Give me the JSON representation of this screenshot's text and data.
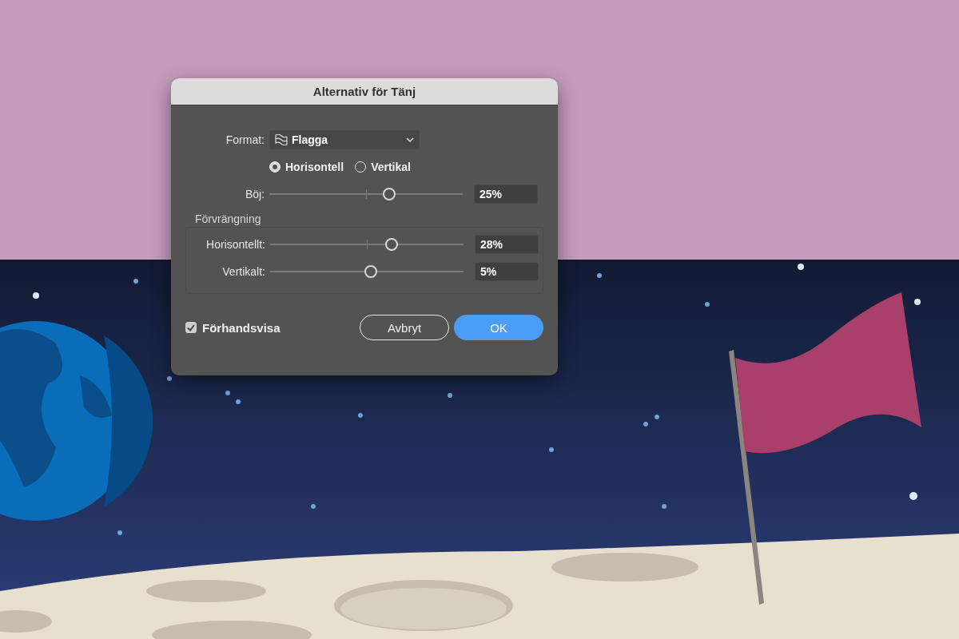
{
  "dialog": {
    "title": "Alternativ för Tänj"
  },
  "format": {
    "label": "Format:",
    "value": "Flagga"
  },
  "orientation": [
    {
      "label": "Horisontell",
      "selected": true
    },
    {
      "label": "Vertikal",
      "selected": false
    }
  ],
  "bend": {
    "label": "Böj:",
    "level": 0.62,
    "value": "25%"
  },
  "distortion": {
    "title": "Förvrängning",
    "sliders": [
      {
        "label": "Horisontellt:",
        "level": 0.63,
        "value": "28%"
      },
      {
        "label": "Vertikalt:",
        "level": 0.52,
        "value": "5%"
      }
    ]
  },
  "preview": {
    "label": "Förhandsvisa",
    "checked": true
  },
  "buttons": [
    {
      "label": "Avbryt",
      "kind": "secondary"
    },
    {
      "label": "OK",
      "kind": "primary"
    }
  ]
}
